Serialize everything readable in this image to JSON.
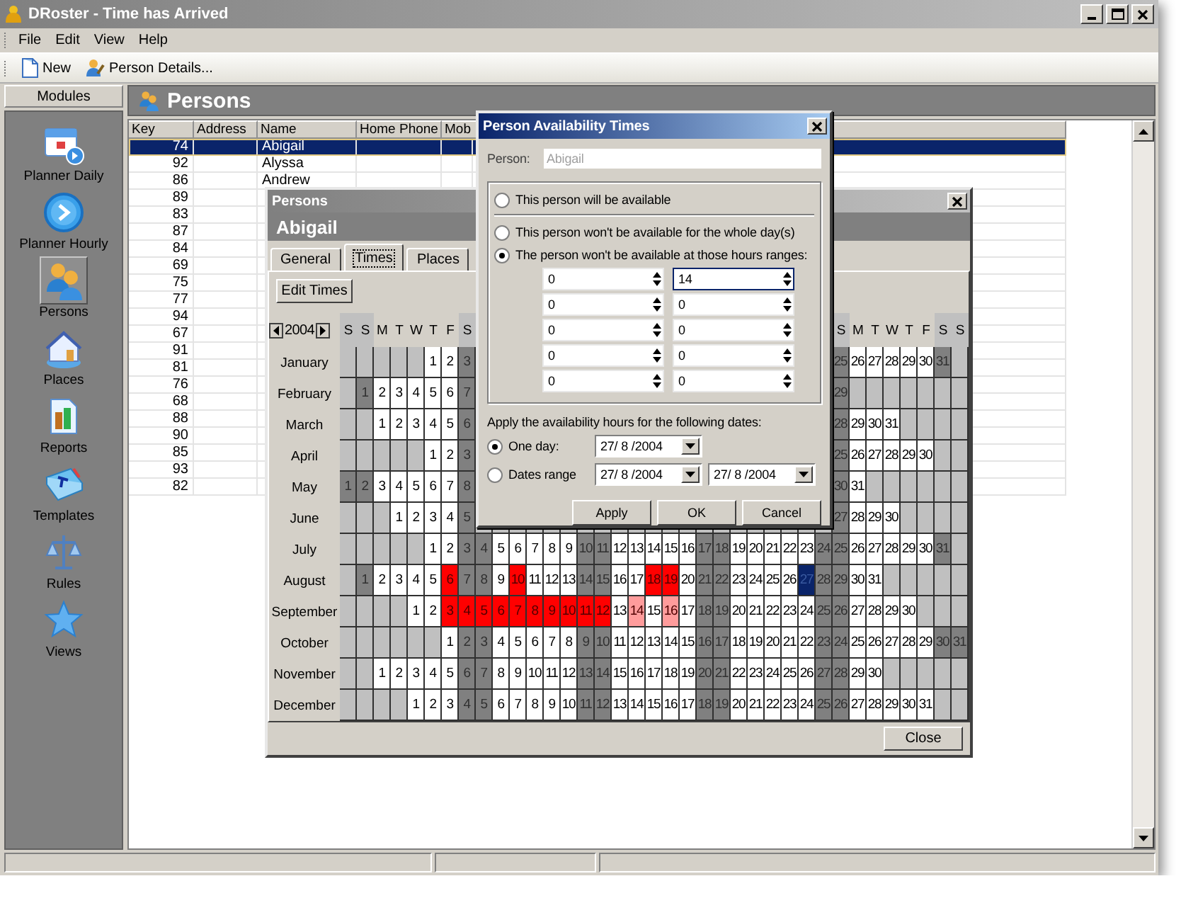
{
  "window": {
    "title": "DRoster - Time has Arrived"
  },
  "menu": [
    "File",
    "Edit",
    "View",
    "Help"
  ],
  "toolbar": [
    {
      "label": "New",
      "kind": "new"
    },
    {
      "label": "Person Details...",
      "kind": "details"
    }
  ],
  "sidebar": {
    "title": "Modules",
    "items": [
      {
        "label": "Planner Daily",
        "kind": "planner-daily",
        "selected": false
      },
      {
        "label": "Planner Hourly",
        "kind": "planner-hourly",
        "selected": false
      },
      {
        "label": "Persons",
        "kind": "persons",
        "selected": true
      },
      {
        "label": "Places",
        "kind": "places",
        "selected": false
      },
      {
        "label": "Reports",
        "kind": "reports",
        "selected": false
      },
      {
        "label": "Templates",
        "kind": "templates",
        "selected": false
      },
      {
        "label": "Rules",
        "kind": "rules",
        "selected": false
      },
      {
        "label": "Views",
        "kind": "views",
        "selected": false
      }
    ]
  },
  "main": {
    "title": "Persons",
    "table": {
      "columns": [
        "Key",
        "Address",
        "Name",
        "Home Phone",
        "Mob"
      ],
      "rows": [
        {
          "key": "74",
          "name": "Abigail",
          "selected": true
        },
        {
          "key": "92",
          "name": "Alyssa",
          "selected": false
        },
        {
          "key": "86",
          "name": "Andrew",
          "selected": false
        },
        {
          "key": "89",
          "selected": false
        },
        {
          "key": "83",
          "selected": false
        },
        {
          "key": "87",
          "selected": false
        },
        {
          "key": "84",
          "selected": false
        },
        {
          "key": "69",
          "selected": false
        },
        {
          "key": "75",
          "selected": false
        },
        {
          "key": "77",
          "selected": false
        },
        {
          "key": "94",
          "selected": false
        },
        {
          "key": "67",
          "selected": false
        },
        {
          "key": "91",
          "selected": false
        },
        {
          "key": "81",
          "selected": false
        },
        {
          "key": "76",
          "selected": false
        },
        {
          "key": "68",
          "selected": false
        },
        {
          "key": "88",
          "selected": false
        },
        {
          "key": "90",
          "selected": false
        },
        {
          "key": "85",
          "selected": false
        },
        {
          "key": "93",
          "selected": false
        },
        {
          "key": "82",
          "selected": false
        }
      ]
    }
  },
  "persons_dialog": {
    "title": "Persons",
    "header": "Abigail",
    "tabs": [
      {
        "label": "General",
        "selected": false
      },
      {
        "label": "Times",
        "selected": true
      },
      {
        "label": "Places",
        "selected": false
      }
    ],
    "edit_button": "Edit Times",
    "year": "2004",
    "day_headers_left": [
      "S",
      "S",
      "M",
      "T",
      "W",
      "T",
      "F",
      "S"
    ],
    "day_headers_right": [
      "S",
      "M",
      "T",
      "W",
      "T",
      "F",
      "S",
      "S"
    ],
    "months": [
      {
        "label": "January",
        "days": [
          {
            "day": "1",
            "kind": "free",
            "selected": false
          },
          {
            "day": "2",
            "kind": "free",
            "selected": false
          },
          {
            "day": "3",
            "kind": "free",
            "selected": false
          },
          {
            "day": "25",
            "kind": "free",
            "selected": false
          },
          {
            "day": "26",
            "kind": "free",
            "selected": false
          },
          {
            "day": "27",
            "kind": "free",
            "selected": false
          },
          {
            "day": "28",
            "kind": "free",
            "selected": false
          },
          {
            "day": "29",
            "kind": "free",
            "selected": false
          },
          {
            "day": "30",
            "kind": "free",
            "selected": false
          },
          {
            "day": "31",
            "kind": "free",
            "selected": false
          }
        ]
      },
      {
        "label": "February",
        "days": [
          {
            "day": "1",
            "kind": "free",
            "selected": false
          },
          {
            "day": "2",
            "kind": "free",
            "selected": false
          },
          {
            "day": "3",
            "kind": "free",
            "selected": false
          },
          {
            "day": "4",
            "kind": "free",
            "selected": false
          },
          {
            "day": "5",
            "kind": "free",
            "selected": false
          },
          {
            "day": "6",
            "kind": "free",
            "selected": false
          },
          {
            "day": "7",
            "kind": "free",
            "selected": false
          },
          {
            "day": "29",
            "kind": "free",
            "selected": false
          }
        ]
      },
      {
        "label": "March",
        "days": [
          {
            "day": "1",
            "kind": "free",
            "selected": false
          },
          {
            "day": "2",
            "kind": "free",
            "selected": false
          },
          {
            "day": "3",
            "kind": "free",
            "selected": false
          },
          {
            "day": "4",
            "kind": "free",
            "selected": false
          },
          {
            "day": "5",
            "kind": "free",
            "selected": false
          },
          {
            "day": "6",
            "kind": "free",
            "selected": false
          },
          {
            "day": "28",
            "kind": "free",
            "selected": false
          },
          {
            "day": "29",
            "kind": "free",
            "selected": false
          },
          {
            "day": "30",
            "kind": "free",
            "selected": false
          },
          {
            "day": "31",
            "kind": "free",
            "selected": false
          }
        ]
      },
      {
        "label": "April",
        "days": [
          {
            "day": "1",
            "kind": "free",
            "selected": false
          },
          {
            "day": "2",
            "kind": "free",
            "selected": false
          },
          {
            "day": "3",
            "kind": "free",
            "selected": false
          },
          {
            "day": "25",
            "kind": "free",
            "selected": false
          },
          {
            "day": "26",
            "kind": "free",
            "selected": false
          },
          {
            "day": "27",
            "kind": "free",
            "selected": false
          },
          {
            "day": "28",
            "kind": "free",
            "selected": false
          },
          {
            "day": "29",
            "kind": "free",
            "selected": false
          },
          {
            "day": "30",
            "kind": "free",
            "selected": false
          }
        ]
      },
      {
        "label": "May",
        "days": [
          {
            "day": "1",
            "kind": "free",
            "selected": false
          },
          {
            "day": "2",
            "kind": "free",
            "selected": false
          },
          {
            "day": "3",
            "kind": "free",
            "selected": false
          },
          {
            "day": "4",
            "kind": "free",
            "selected": false
          },
          {
            "day": "5",
            "kind": "free",
            "selected": false
          },
          {
            "day": "6",
            "kind": "free",
            "selected": false
          },
          {
            "day": "7",
            "kind": "free",
            "selected": false
          },
          {
            "day": "8",
            "kind": "free",
            "selected": false
          },
          {
            "day": "30",
            "kind": "free",
            "selected": false
          },
          {
            "day": "31",
            "kind": "free",
            "selected": false
          }
        ]
      },
      {
        "label": "June",
        "days": [
          {
            "day": "1",
            "kind": "free",
            "selected": false
          },
          {
            "day": "2",
            "kind": "free",
            "selected": false
          },
          {
            "day": "3",
            "kind": "free",
            "selected": false
          },
          {
            "day": "4",
            "kind": "free",
            "selected": false
          },
          {
            "day": "5",
            "kind": "free",
            "selected": false
          },
          {
            "day": "27",
            "kind": "free",
            "selected": false
          },
          {
            "day": "28",
            "kind": "free",
            "selected": false
          },
          {
            "day": "29",
            "kind": "free",
            "selected": false
          },
          {
            "day": "30",
            "kind": "free",
            "selected": false
          }
        ]
      },
      {
        "label": "July",
        "days": [
          {
            "day": "1",
            "kind": "free",
            "selected": false
          },
          {
            "day": "2",
            "kind": "free",
            "selected": false
          },
          {
            "day": "3",
            "kind": "free",
            "selected": false
          },
          {
            "day": "4",
            "kind": "free",
            "selected": false
          },
          {
            "day": "5",
            "kind": "free",
            "selected": false
          },
          {
            "day": "6",
            "kind": "free",
            "selected": false
          },
          {
            "day": "7",
            "kind": "free",
            "selected": false
          },
          {
            "day": "8",
            "kind": "free",
            "selected": false
          },
          {
            "day": "9",
            "kind": "free",
            "selected": false
          },
          {
            "day": "10",
            "kind": "free",
            "selected": false
          },
          {
            "day": "11",
            "kind": "free",
            "selected": false
          },
          {
            "day": "12",
            "kind": "free",
            "selected": false
          },
          {
            "day": "13",
            "kind": "free",
            "selected": false
          },
          {
            "day": "14",
            "kind": "free",
            "selected": false
          },
          {
            "day": "15",
            "kind": "free",
            "selected": false
          },
          {
            "day": "16",
            "kind": "free",
            "selected": false
          },
          {
            "day": "17",
            "kind": "free",
            "selected": false
          },
          {
            "day": "18",
            "kind": "free",
            "selected": false
          },
          {
            "day": "19",
            "kind": "free",
            "selected": false
          },
          {
            "day": "20",
            "kind": "free",
            "selected": false
          },
          {
            "day": "21",
            "kind": "free",
            "selected": false
          },
          {
            "day": "22",
            "kind": "free",
            "selected": false
          },
          {
            "day": "23",
            "kind": "free",
            "selected": false
          },
          {
            "day": "24",
            "kind": "free",
            "selected": false
          },
          {
            "day": "25",
            "kind": "free",
            "selected": false
          },
          {
            "day": "26",
            "kind": "free",
            "selected": false
          },
          {
            "day": "27",
            "kind": "free",
            "selected": false
          },
          {
            "day": "28",
            "kind": "free",
            "selected": false
          },
          {
            "day": "29",
            "kind": "free",
            "selected": false
          },
          {
            "day": "30",
            "kind": "free",
            "selected": false
          },
          {
            "day": "31",
            "kind": "free",
            "selected": false
          }
        ]
      },
      {
        "label": "August",
        "days": [
          {
            "day": "1",
            "kind": "free",
            "selected": false
          },
          {
            "day": "2",
            "kind": "free",
            "selected": false
          },
          {
            "day": "3",
            "kind": "free",
            "selected": false
          },
          {
            "day": "4",
            "kind": "free",
            "selected": false
          },
          {
            "day": "5",
            "kind": "free",
            "selected": false
          },
          {
            "day": "6",
            "kind": "busy",
            "selected": false
          },
          {
            "day": "7",
            "kind": "free",
            "selected": false
          },
          {
            "day": "8",
            "kind": "free",
            "selected": false
          },
          {
            "day": "9",
            "kind": "free",
            "selected": false
          },
          {
            "day": "10",
            "kind": "busy",
            "selected": false
          },
          {
            "day": "11",
            "kind": "free",
            "selected": false
          },
          {
            "day": "12",
            "kind": "free",
            "selected": false
          },
          {
            "day": "13",
            "kind": "free",
            "selected": false
          },
          {
            "day": "14",
            "kind": "free",
            "selected": false
          },
          {
            "day": "15",
            "kind": "free",
            "selected": false
          },
          {
            "day": "16",
            "kind": "free",
            "selected": false
          },
          {
            "day": "17",
            "kind": "free",
            "selected": false
          },
          {
            "day": "18",
            "kind": "busy",
            "selected": false
          },
          {
            "day": "19",
            "kind": "busy",
            "selected": false
          },
          {
            "day": "20",
            "kind": "free",
            "selected": false
          },
          {
            "day": "21",
            "kind": "free",
            "selected": false
          },
          {
            "day": "22",
            "kind": "free",
            "selected": false
          },
          {
            "day": "23",
            "kind": "free",
            "selected": false
          },
          {
            "day": "24",
            "kind": "free",
            "selected": false
          },
          {
            "day": "25",
            "kind": "free",
            "selected": false
          },
          {
            "day": "26",
            "kind": "free",
            "selected": false
          },
          {
            "day": "27",
            "kind": "free",
            "selected": true
          },
          {
            "day": "28",
            "kind": "free",
            "selected": false
          },
          {
            "day": "29",
            "kind": "free",
            "selected": false
          },
          {
            "day": "30",
            "kind": "free",
            "selected": false
          },
          {
            "day": "31",
            "kind": "free",
            "selected": false
          }
        ]
      },
      {
        "label": "September",
        "days": [
          {
            "day": "1",
            "kind": "free",
            "selected": false
          },
          {
            "day": "2",
            "kind": "free",
            "selected": false
          },
          {
            "day": "3",
            "kind": "busy",
            "selected": false
          },
          {
            "day": "4",
            "kind": "busy",
            "selected": false
          },
          {
            "day": "5",
            "kind": "busy",
            "selected": false
          },
          {
            "day": "6",
            "kind": "busy",
            "selected": false
          },
          {
            "day": "7",
            "kind": "busy",
            "selected": false
          },
          {
            "day": "8",
            "kind": "busy",
            "selected": false
          },
          {
            "day": "9",
            "kind": "busy",
            "selected": false
          },
          {
            "day": "10",
            "kind": "busy",
            "selected": false
          },
          {
            "day": "11",
            "kind": "busy",
            "selected": false
          },
          {
            "day": "12",
            "kind": "busy",
            "selected": false
          },
          {
            "day": "13",
            "kind": "free",
            "selected": false
          },
          {
            "day": "14",
            "kind": "partial",
            "selected": false
          },
          {
            "day": "15",
            "kind": "free",
            "selected": false
          },
          {
            "day": "16",
            "kind": "partial",
            "selected": false
          },
          {
            "day": "17",
            "kind": "free",
            "selected": false
          },
          {
            "day": "18",
            "kind": "free",
            "selected": false
          },
          {
            "day": "19",
            "kind": "free",
            "selected": false
          },
          {
            "day": "20",
            "kind": "free",
            "selected": false
          },
          {
            "day": "21",
            "kind": "free",
            "selected": false
          },
          {
            "day": "22",
            "kind": "free",
            "selected": false
          },
          {
            "day": "23",
            "kind": "free",
            "selected": false
          },
          {
            "day": "24",
            "kind": "free",
            "selected": false
          },
          {
            "day": "25",
            "kind": "free",
            "selected": false
          },
          {
            "day": "26",
            "kind": "free",
            "selected": false
          },
          {
            "day": "27",
            "kind": "free",
            "selected": false
          },
          {
            "day": "28",
            "kind": "free",
            "selected": false
          },
          {
            "day": "29",
            "kind": "free",
            "selected": false
          },
          {
            "day": "30",
            "kind": "free",
            "selected": false
          }
        ]
      },
      {
        "label": "October",
        "days": [
          {
            "day": "1",
            "kind": "free",
            "selected": false
          },
          {
            "day": "2",
            "kind": "free",
            "selected": false
          },
          {
            "day": "3",
            "kind": "free",
            "selected": false
          },
          {
            "day": "4",
            "kind": "free",
            "selected": false
          },
          {
            "day": "5",
            "kind": "free",
            "selected": false
          },
          {
            "day": "6",
            "kind": "free",
            "selected": false
          },
          {
            "day": "7",
            "kind": "free",
            "selected": false
          },
          {
            "day": "8",
            "kind": "free",
            "selected": false
          },
          {
            "day": "9",
            "kind": "free",
            "selected": false
          },
          {
            "day": "10",
            "kind": "free",
            "selected": false
          },
          {
            "day": "11",
            "kind": "free",
            "selected": false
          },
          {
            "day": "12",
            "kind": "free",
            "selected": false
          },
          {
            "day": "13",
            "kind": "free",
            "selected": false
          },
          {
            "day": "14",
            "kind": "free",
            "selected": false
          },
          {
            "day": "15",
            "kind": "free",
            "selected": false
          },
          {
            "day": "16",
            "kind": "free",
            "selected": false
          },
          {
            "day": "17",
            "kind": "free",
            "selected": false
          },
          {
            "day": "18",
            "kind": "free",
            "selected": false
          },
          {
            "day": "19",
            "kind": "free",
            "selected": false
          },
          {
            "day": "20",
            "kind": "free",
            "selected": false
          },
          {
            "day": "21",
            "kind": "free",
            "selected": false
          },
          {
            "day": "22",
            "kind": "free",
            "selected": false
          },
          {
            "day": "23",
            "kind": "free",
            "selected": false
          },
          {
            "day": "24",
            "kind": "free",
            "selected": false
          },
          {
            "day": "25",
            "kind": "free",
            "selected": false
          },
          {
            "day": "26",
            "kind": "free",
            "selected": false
          },
          {
            "day": "27",
            "kind": "free",
            "selected": false
          },
          {
            "day": "28",
            "kind": "free",
            "selected": false
          },
          {
            "day": "29",
            "kind": "free",
            "selected": false
          },
          {
            "day": "30",
            "kind": "free",
            "selected": false
          },
          {
            "day": "31",
            "kind": "free",
            "selected": false
          }
        ]
      },
      {
        "label": "November",
        "days": [
          {
            "day": "1",
            "kind": "free",
            "selected": false
          },
          {
            "day": "2",
            "kind": "free",
            "selected": false
          },
          {
            "day": "3",
            "kind": "free",
            "selected": false
          },
          {
            "day": "4",
            "kind": "free",
            "selected": false
          },
          {
            "day": "5",
            "kind": "free",
            "selected": false
          },
          {
            "day": "6",
            "kind": "free",
            "selected": false
          },
          {
            "day": "7",
            "kind": "free",
            "selected": false
          },
          {
            "day": "8",
            "kind": "free",
            "selected": false
          },
          {
            "day": "9",
            "kind": "free",
            "selected": false
          },
          {
            "day": "10",
            "kind": "free",
            "selected": false
          },
          {
            "day": "11",
            "kind": "free",
            "selected": false
          },
          {
            "day": "12",
            "kind": "free",
            "selected": false
          },
          {
            "day": "13",
            "kind": "free",
            "selected": false
          },
          {
            "day": "14",
            "kind": "free",
            "selected": false
          },
          {
            "day": "15",
            "kind": "free",
            "selected": false
          },
          {
            "day": "16",
            "kind": "free",
            "selected": false
          },
          {
            "day": "17",
            "kind": "free",
            "selected": false
          },
          {
            "day": "18",
            "kind": "free",
            "selected": false
          },
          {
            "day": "19",
            "kind": "free",
            "selected": false
          },
          {
            "day": "20",
            "kind": "free",
            "selected": false
          },
          {
            "day": "21",
            "kind": "free",
            "selected": false
          },
          {
            "day": "22",
            "kind": "free",
            "selected": false
          },
          {
            "day": "23",
            "kind": "free",
            "selected": false
          },
          {
            "day": "24",
            "kind": "free",
            "selected": false
          },
          {
            "day": "25",
            "kind": "free",
            "selected": false
          },
          {
            "day": "26",
            "kind": "free",
            "selected": false
          },
          {
            "day": "27",
            "kind": "free",
            "selected": false
          },
          {
            "day": "28",
            "kind": "free",
            "selected": false
          },
          {
            "day": "29",
            "kind": "free",
            "selected": false
          },
          {
            "day": "30",
            "kind": "free",
            "selected": false
          }
        ]
      },
      {
        "label": "December",
        "days": [
          {
            "day": "1",
            "kind": "free",
            "selected": false
          },
          {
            "day": "2",
            "kind": "free",
            "selected": false
          },
          {
            "day": "3",
            "kind": "free",
            "selected": false
          },
          {
            "day": "4",
            "kind": "free",
            "selected": false
          },
          {
            "day": "5",
            "kind": "free",
            "selected": false
          },
          {
            "day": "6",
            "kind": "free",
            "selected": false
          },
          {
            "day": "7",
            "kind": "free",
            "selected": false
          },
          {
            "day": "8",
            "kind": "free",
            "selected": false
          },
          {
            "day": "9",
            "kind": "free",
            "selected": false
          },
          {
            "day": "10",
            "kind": "free",
            "selected": false
          },
          {
            "day": "11",
            "kind": "free",
            "selected": false
          },
          {
            "day": "12",
            "kind": "free",
            "selected": false
          },
          {
            "day": "13",
            "kind": "free",
            "selected": false
          },
          {
            "day": "14",
            "kind": "free",
            "selected": false
          },
          {
            "day": "15",
            "kind": "free",
            "selected": false
          },
          {
            "day": "16",
            "kind": "free",
            "selected": false
          },
          {
            "day": "17",
            "kind": "free",
            "selected": false
          },
          {
            "day": "18",
            "kind": "free",
            "selected": false
          },
          {
            "day": "19",
            "kind": "free",
            "selected": false
          },
          {
            "day": "20",
            "kind": "free",
            "selected": false
          },
          {
            "day": "21",
            "kind": "free",
            "selected": false
          },
          {
            "day": "22",
            "kind": "free",
            "selected": false
          },
          {
            "day": "23",
            "kind": "free",
            "selected": false
          },
          {
            "day": "24",
            "kind": "free",
            "selected": false
          },
          {
            "day": "25",
            "kind": "free",
            "selected": false
          },
          {
            "day": "26",
            "kind": "free",
            "selected": false
          },
          {
            "day": "27",
            "kind": "free",
            "selected": false
          },
          {
            "day": "28",
            "kind": "free",
            "selected": false
          },
          {
            "day": "29",
            "kind": "free",
            "selected": false
          },
          {
            "day": "30",
            "kind": "free",
            "selected": false
          },
          {
            "day": "31",
            "kind": "free",
            "selected": false
          }
        ]
      }
    ],
    "close_button": "Close"
  },
  "availability_dialog": {
    "title": "Person Availability Times",
    "person": {
      "label": "Person:",
      "value": "Abigail",
      "disabled": true
    },
    "options": [
      {
        "label": "This person will be available",
        "selected": false
      },
      {
        "label": "This person won't be available for the whole day(s)",
        "selected": false
      },
      {
        "label": "The person won't be available at those hours ranges:",
        "selected": true
      }
    ],
    "hour_ranges": [
      {
        "from": "0",
        "to": "14",
        "to_focused": true
      },
      {
        "from": "0",
        "to": "0",
        "to_focused": false
      },
      {
        "from": "0",
        "to": "0",
        "to_focused": false
      },
      {
        "from": "0",
        "to": "0",
        "to_focused": false
      },
      {
        "from": "0",
        "to": "0",
        "to_focused": false
      }
    ],
    "dates_label": "Apply the availability hours for the following dates:",
    "date_options": [
      {
        "label": "One day:",
        "selected": true,
        "dates": [
          "27/ 8 /2004"
        ]
      },
      {
        "label": "Dates range",
        "selected": false,
        "dates": [
          "27/ 8 /2004",
          "27/ 8 /2004"
        ]
      }
    ],
    "buttons": [
      "Apply",
      "OK",
      "Cancel"
    ]
  }
}
